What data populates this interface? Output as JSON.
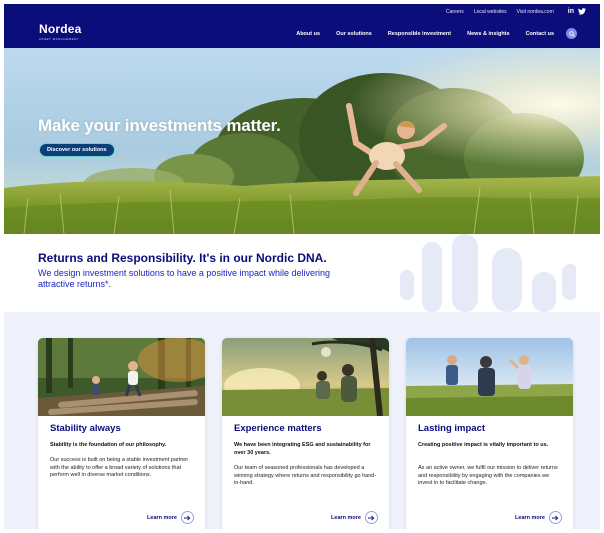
{
  "colors": {
    "brand_navy": "#0b0d7a",
    "brand_blue": "#1c24c2",
    "accent_teal": "#6fd2d0",
    "deco_lavender": "#e6e9f6"
  },
  "utility_bar": {
    "links": [
      "Careers",
      "Local websites",
      "Visit nordea.com"
    ],
    "social": {
      "linkedin": "in",
      "twitter_icon": "twitter-icon"
    }
  },
  "header": {
    "logo": {
      "word": "Nordea",
      "sub": "ASSET MANAGEMENT"
    },
    "nav": [
      "About us",
      "Our solutions",
      "Responsible investment",
      "News & insights",
      "Contact us"
    ],
    "search_icon": "search-icon"
  },
  "hero": {
    "title": "Make your investments matter.",
    "cta": "Discover our solutions"
  },
  "intro": {
    "heading": "Returns and Responsibility. It's in our Nordic DNA.",
    "body": "We design investment solutions to have a positive impact while delivering attractive returns*."
  },
  "cards": [
    {
      "title": "Stability always",
      "lead": "Stability is the foundation of our philosophy.",
      "body": "Our success is built on being a stable investment partner with the ability to offer a broad variety of solutions that perform well in diverse market conditions.",
      "link": "Learn more",
      "image": "children balancing on logs in a forest"
    },
    {
      "title": "Experience matters",
      "lead": "We have been integrating ESG and sustainability for over 30 years.",
      "body": "Our team of seasoned professionals has developed a winning strategy where returns and responsibility go hand-in-hand.",
      "link": "Learn more",
      "image": "man and child under a tree with a dandelion at sunset"
    },
    {
      "title": "Lasting impact",
      "lead": "Creating positive impact is vitally important to us.",
      "body": "As an active owner, we fulfil our mission to deliver returns and responsibility by engaging with the companies we invest in to facilitate change.",
      "link": "Learn more",
      "image": "family looking through binoculars in a field"
    }
  ]
}
